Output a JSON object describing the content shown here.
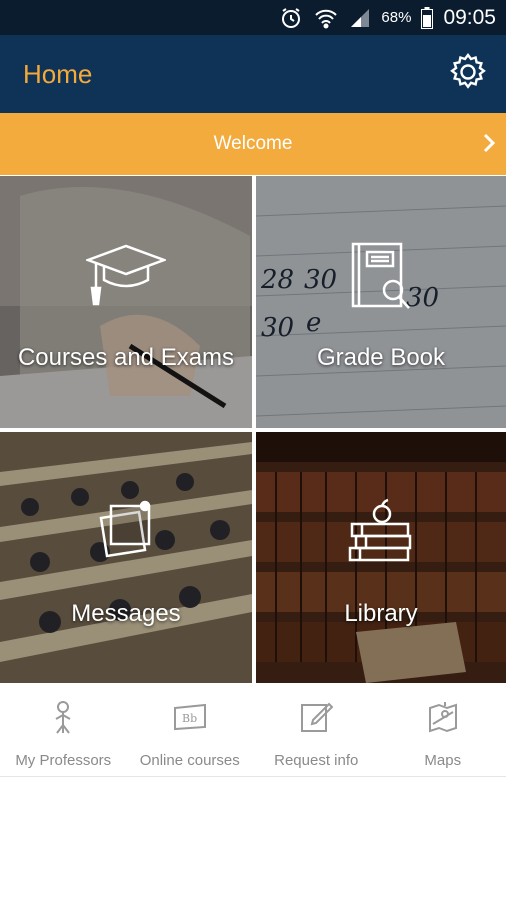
{
  "status_bar": {
    "battery": "68%",
    "time": "09:05",
    "icons": [
      "alarm-icon",
      "wifi-icon",
      "signal-icon",
      "battery-icon"
    ]
  },
  "app_bar": {
    "title": "Home",
    "settings_icon": "gear-icon"
  },
  "welcome": {
    "label": "Welcome",
    "icon": "chevron-right-icon"
  },
  "tiles": [
    {
      "label": "Courses and Exams",
      "icon": "graduation-cap-icon"
    },
    {
      "label": "Grade Book",
      "icon": "notebook-search-icon"
    },
    {
      "label": "Messages",
      "icon": "notes-icon"
    },
    {
      "label": "Library",
      "icon": "books-apple-icon"
    }
  ],
  "bottom_nav": [
    {
      "label": "My Professors",
      "icon": "professor-icon"
    },
    {
      "label": "Online courses",
      "icon": "bb-icon"
    },
    {
      "label": "Request info",
      "icon": "edit-icon"
    },
    {
      "label": "Maps",
      "icon": "map-icon"
    }
  ],
  "colors": {
    "status_bar": "#0b1c2e",
    "app_bar": "#0f3357",
    "accent": "#f4ab3e",
    "nav_text": "#8a8a8a"
  }
}
